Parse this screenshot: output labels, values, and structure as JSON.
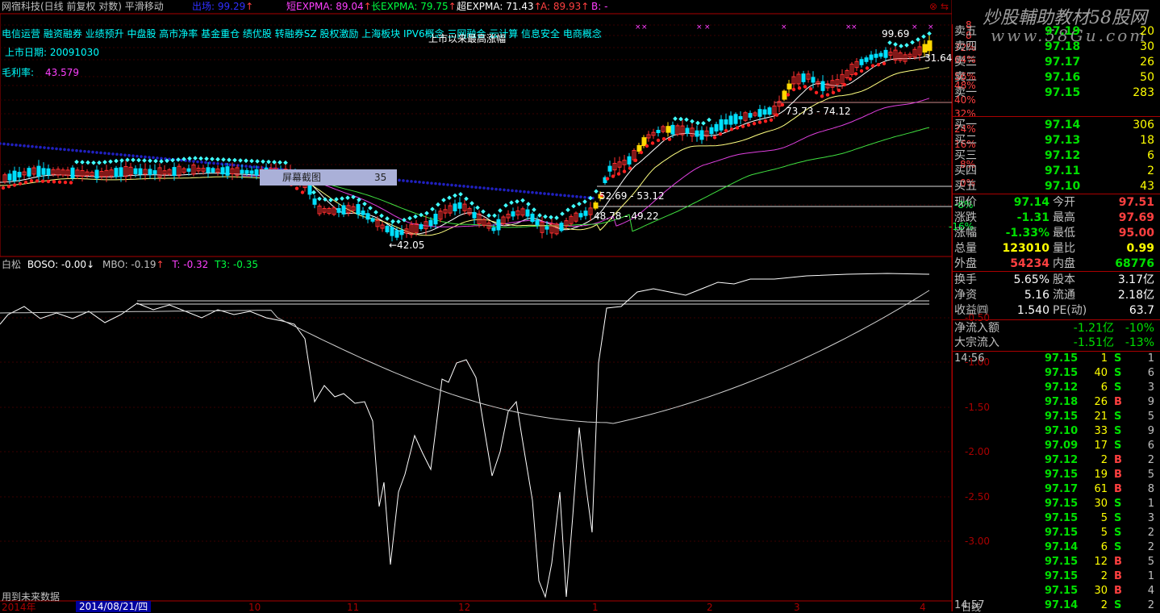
{
  "header": {
    "title": "网宿科技(日线 前复权 对数) 平滑移动",
    "ma_label": "出场: 99.29",
    "ind1_label": "短EXPMA: 89.04",
    "ind2_label": "长EXPMA: 79.75",
    "ind3_label": "超EXPMA: 71.43",
    "ind4_label": "A: 89.93",
    "ind5_label": "B: -",
    "arrow": "↑",
    "window_buttons": [
      "⊗",
      "⇆"
    ]
  },
  "concepts": "电信运营 融资融券 业绩预升 中盘股 高市净率 基金重仓 绩优股 转融券SZ 股权激励 上海板块 IPV6概念 三网融合 云计算 信息安全 电商概念",
  "overlay_text": "上市以来最高涨幅",
  "listing": {
    "label": "上市日期:",
    "value": "20091030"
  },
  "margin": {
    "label": "毛利率:",
    "value": "43.579"
  },
  "screen_box": {
    "label": "屏幕截图",
    "value": "35"
  },
  "price_annotations": [
    "99.69",
    "73.73 - 74.12",
    "52.69 - 53.12",
    "48.78 - 49.22",
    "←42.05",
    "31.64"
  ],
  "pct_axis": [
    "8",
    "8",
    "72%",
    "64%",
    "56%",
    "48%",
    "40%",
    "32%",
    "24%",
    "16%",
    "8%",
    "0%",
    "-8%",
    "-16%"
  ],
  "lower_header": {
    "name": "白松",
    "boso": "BOSO: -0.00",
    "boso_arrow": "↓",
    "mbo": "MBO: -0.19",
    "mbo_arrow": "↑",
    "t": "T: -0.32",
    "t3": "T3: -0.35"
  },
  "lower_axis": [
    "-0.50",
    "-1.00",
    "-1.50",
    "-2.00",
    "-2.50",
    "-3.00"
  ],
  "footer": {
    "note": "用到未来数据",
    "year": "2014年",
    "date": "2014/08/21/四",
    "months": [
      "10",
      "11",
      "12",
      "1",
      "2",
      "3",
      "4"
    ],
    "period": "日线"
  },
  "watermark": {
    "line1": "炒股輔助教材58股网",
    "line2": "www.58Gu.com"
  },
  "order_book": {
    "sells": [
      {
        "label": "卖五",
        "price": "97.19",
        "vol": "20"
      },
      {
        "label": "卖四",
        "price": "97.18",
        "vol": "30"
      },
      {
        "label": "卖三",
        "price": "97.17",
        "vol": "26"
      },
      {
        "label": "卖二",
        "price": "97.16",
        "vol": "50"
      },
      {
        "label": "卖一",
        "price": "97.15",
        "vol": "283"
      }
    ],
    "buys": [
      {
        "label": "买一",
        "price": "97.14",
        "vol": "306"
      },
      {
        "label": "买二",
        "price": "97.13",
        "vol": "18"
      },
      {
        "label": "买三",
        "price": "97.12",
        "vol": "6"
      },
      {
        "label": "买四",
        "price": "97.11",
        "vol": "2"
      },
      {
        "label": "买五",
        "price": "97.10",
        "vol": "43"
      }
    ]
  },
  "quote": [
    {
      "l1": "现价",
      "v1": "97.14",
      "l2": "今开",
      "v2": "97.51"
    },
    {
      "l1": "涨跌",
      "v1": "-1.31",
      "l2": "最高",
      "v2": "97.69"
    },
    {
      "l1": "涨幅",
      "v1": "-1.33%",
      "l2": "最低",
      "v2": "95.00"
    },
    {
      "l1": "总量",
      "v1": "123010",
      "l2": "量比",
      "v2": "0.99"
    },
    {
      "l1": "外盘",
      "v1": "54234",
      "l2": "内盘",
      "v2": "68776"
    }
  ],
  "stats": [
    {
      "l1": "换手",
      "v1": "5.65%",
      "l2": "股本",
      "v2": "3.17亿"
    },
    {
      "l1": "净资",
      "v1": "5.16",
      "l2": "流通",
      "v2": "2.18亿"
    },
    {
      "l1": "收益㈣",
      "v1": "1.540",
      "l2": "PE(动)",
      "v2": "63.7"
    }
  ],
  "flows": [
    {
      "label": "净流入额",
      "value": "-1.21亿",
      "pct": "-10%"
    },
    {
      "label": "大宗流入",
      "value": "-1.51亿",
      "pct": "-13%"
    }
  ],
  "ticks": [
    {
      "time": "14:56",
      "price": "97.15",
      "vol": "1",
      "side": "S",
      "n": "1"
    },
    {
      "time": "",
      "price": "97.15",
      "vol": "40",
      "side": "S",
      "n": "6"
    },
    {
      "time": "",
      "price": "97.12",
      "vol": "6",
      "side": "S",
      "n": "3"
    },
    {
      "time": "",
      "price": "97.18",
      "vol": "26",
      "side": "B",
      "n": "9"
    },
    {
      "time": "",
      "price": "97.15",
      "vol": "21",
      "side": "S",
      "n": "5"
    },
    {
      "time": "",
      "price": "97.10",
      "vol": "33",
      "side": "S",
      "n": "9"
    },
    {
      "time": "",
      "price": "97.09",
      "vol": "17",
      "side": "S",
      "n": "6"
    },
    {
      "time": "",
      "price": "97.12",
      "vol": "2",
      "side": "B",
      "n": "2"
    },
    {
      "time": "",
      "price": "97.15",
      "vol": "19",
      "side": "B",
      "n": "5"
    },
    {
      "time": "",
      "price": "97.17",
      "vol": "61",
      "side": "B",
      "n": "8"
    },
    {
      "time": "",
      "price": "97.15",
      "vol": "30",
      "side": "S",
      "n": "1"
    },
    {
      "time": "",
      "price": "97.15",
      "vol": "5",
      "side": "S",
      "n": "3"
    },
    {
      "time": "",
      "price": "97.15",
      "vol": "5",
      "side": "S",
      "n": "2"
    },
    {
      "time": "",
      "price": "97.14",
      "vol": "6",
      "side": "S",
      "n": "2"
    },
    {
      "time": "",
      "price": "97.15",
      "vol": "12",
      "side": "B",
      "n": "5"
    },
    {
      "time": "",
      "price": "97.15",
      "vol": "2",
      "side": "B",
      "n": "1"
    },
    {
      "time": "",
      "price": "97.15",
      "vol": "30",
      "side": "B",
      "n": "4"
    },
    {
      "time": "14:57",
      "price": "97.14",
      "vol": "2",
      "side": "S",
      "n": "2"
    }
  ],
  "colors": {
    "up": "#ff3333",
    "down": "#00ffff",
    "frame": "#aa0000",
    "accent": "#ffff00"
  }
}
